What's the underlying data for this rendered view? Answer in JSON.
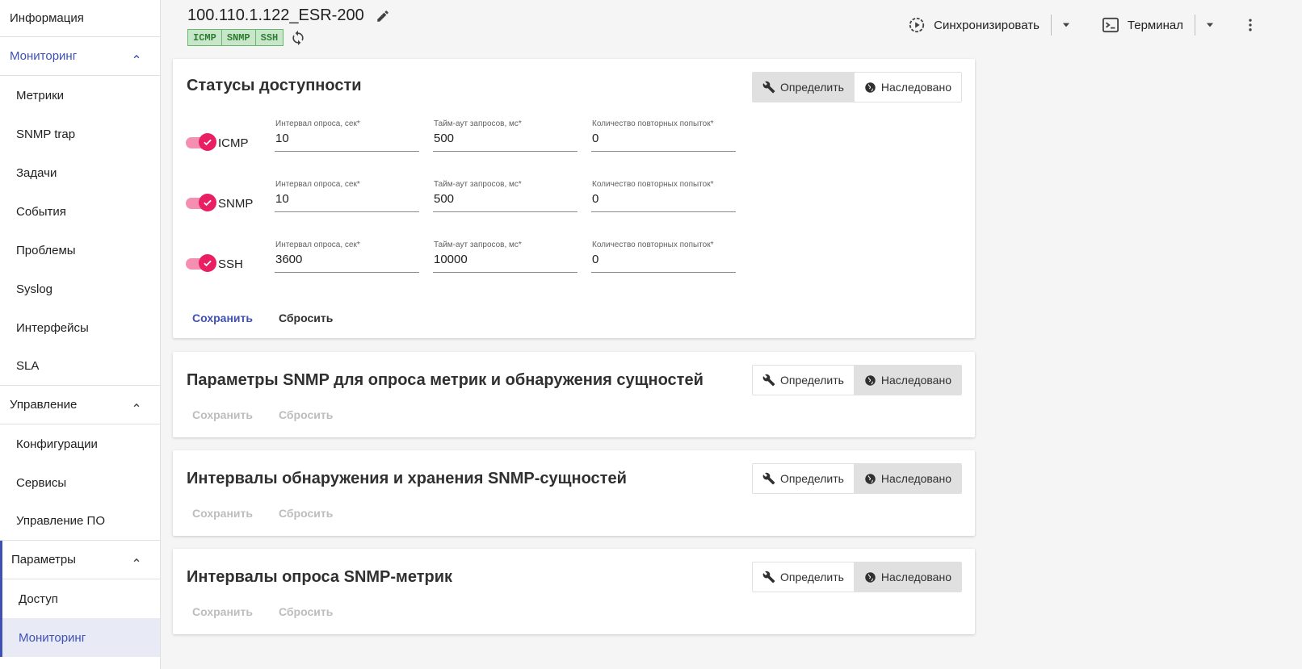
{
  "sidebar": {
    "info": "Информация",
    "monitoring": {
      "label": "Мониторинг",
      "items": [
        "Метрики",
        "SNMP trap",
        "Задачи",
        "События",
        "Проблемы",
        "Syslog",
        "Интерфейсы",
        "SLA"
      ]
    },
    "management": {
      "label": "Управление",
      "items": [
        "Конфигурации",
        "Сервисы",
        "Управление ПО"
      ]
    },
    "params": {
      "label": "Параметры",
      "items": [
        "Доступ",
        "Мониторинг"
      ]
    }
  },
  "header": {
    "device_name": "100.110.1.122_ESR-200",
    "chips": [
      "ICMP",
      "SNMP",
      "SSH"
    ],
    "sync_label": "Синхронизировать",
    "terminal_label": "Терминал"
  },
  "toggle": {
    "define": "Определить",
    "inherited": "Наследовано"
  },
  "actions": {
    "save": "Сохранить",
    "reset": "Сбросить"
  },
  "availability": {
    "title": "Статусы доступности",
    "field_labels": {
      "interval": "Интервал опроса, сек*",
      "timeout": "Тайм-аут запросов, мс*",
      "retries": "Количество повторных попыток*"
    },
    "rows": [
      {
        "protocol": "ICMP",
        "interval": "10",
        "timeout": "500",
        "retries": "0"
      },
      {
        "protocol": "SNMP",
        "interval": "10",
        "timeout": "500",
        "retries": "0"
      },
      {
        "protocol": "SSH",
        "interval": "3600",
        "timeout": "10000",
        "retries": "0"
      }
    ]
  },
  "cards": [
    {
      "title": "Параметры SNMP для опроса метрик и обнаружения сущностей"
    },
    {
      "title": "Интервалы обнаружения и хранения SNMP-сущностей"
    },
    {
      "title": "Интервалы опроса SNMP-метрик"
    }
  ],
  "colors": {
    "accent": "#3f51b5",
    "switch": "#e91e63",
    "chip_bg": "#c8e6c9"
  }
}
